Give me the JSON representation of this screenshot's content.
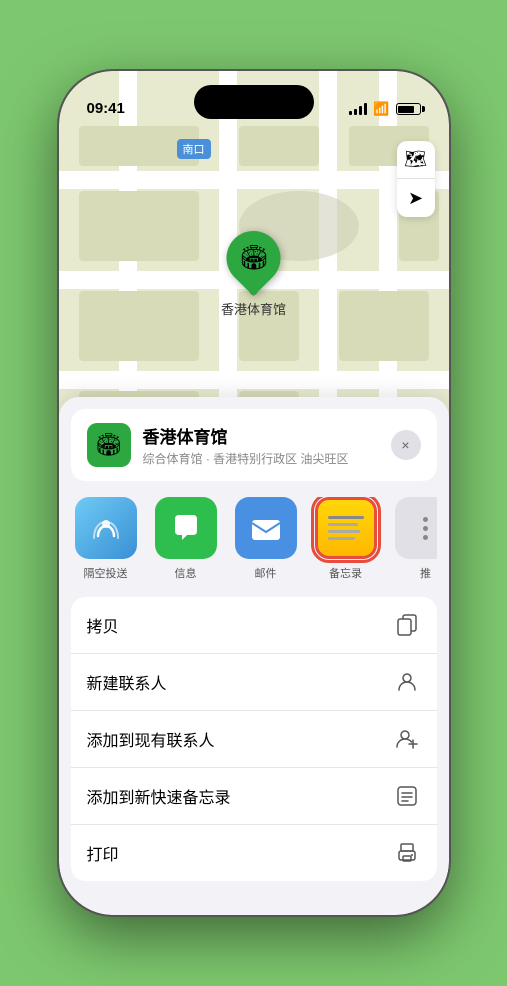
{
  "status_bar": {
    "time": "09:41",
    "location_icon": "▶"
  },
  "map": {
    "location_label": "南口",
    "stadium_name": "香港体育馆",
    "stadium_emoji": "🏟"
  },
  "place_card": {
    "name": "香港体育馆",
    "subtitle": "综合体育馆 · 香港特别行政区 油尖旺区",
    "icon_emoji": "🏟",
    "close_label": "×"
  },
  "share_items": [
    {
      "label": "隔空投送",
      "type": "airdrop"
    },
    {
      "label": "信息",
      "type": "messages"
    },
    {
      "label": "邮件",
      "type": "mail"
    },
    {
      "label": "备忘录",
      "type": "notes"
    },
    {
      "label": "推",
      "type": "more"
    }
  ],
  "action_items": [
    {
      "label": "拷贝",
      "icon": "copy"
    },
    {
      "label": "新建联系人",
      "icon": "person"
    },
    {
      "label": "添加到现有联系人",
      "icon": "person-add"
    },
    {
      "label": "添加到新快速备忘录",
      "icon": "memo"
    },
    {
      "label": "打印",
      "icon": "print"
    }
  ]
}
